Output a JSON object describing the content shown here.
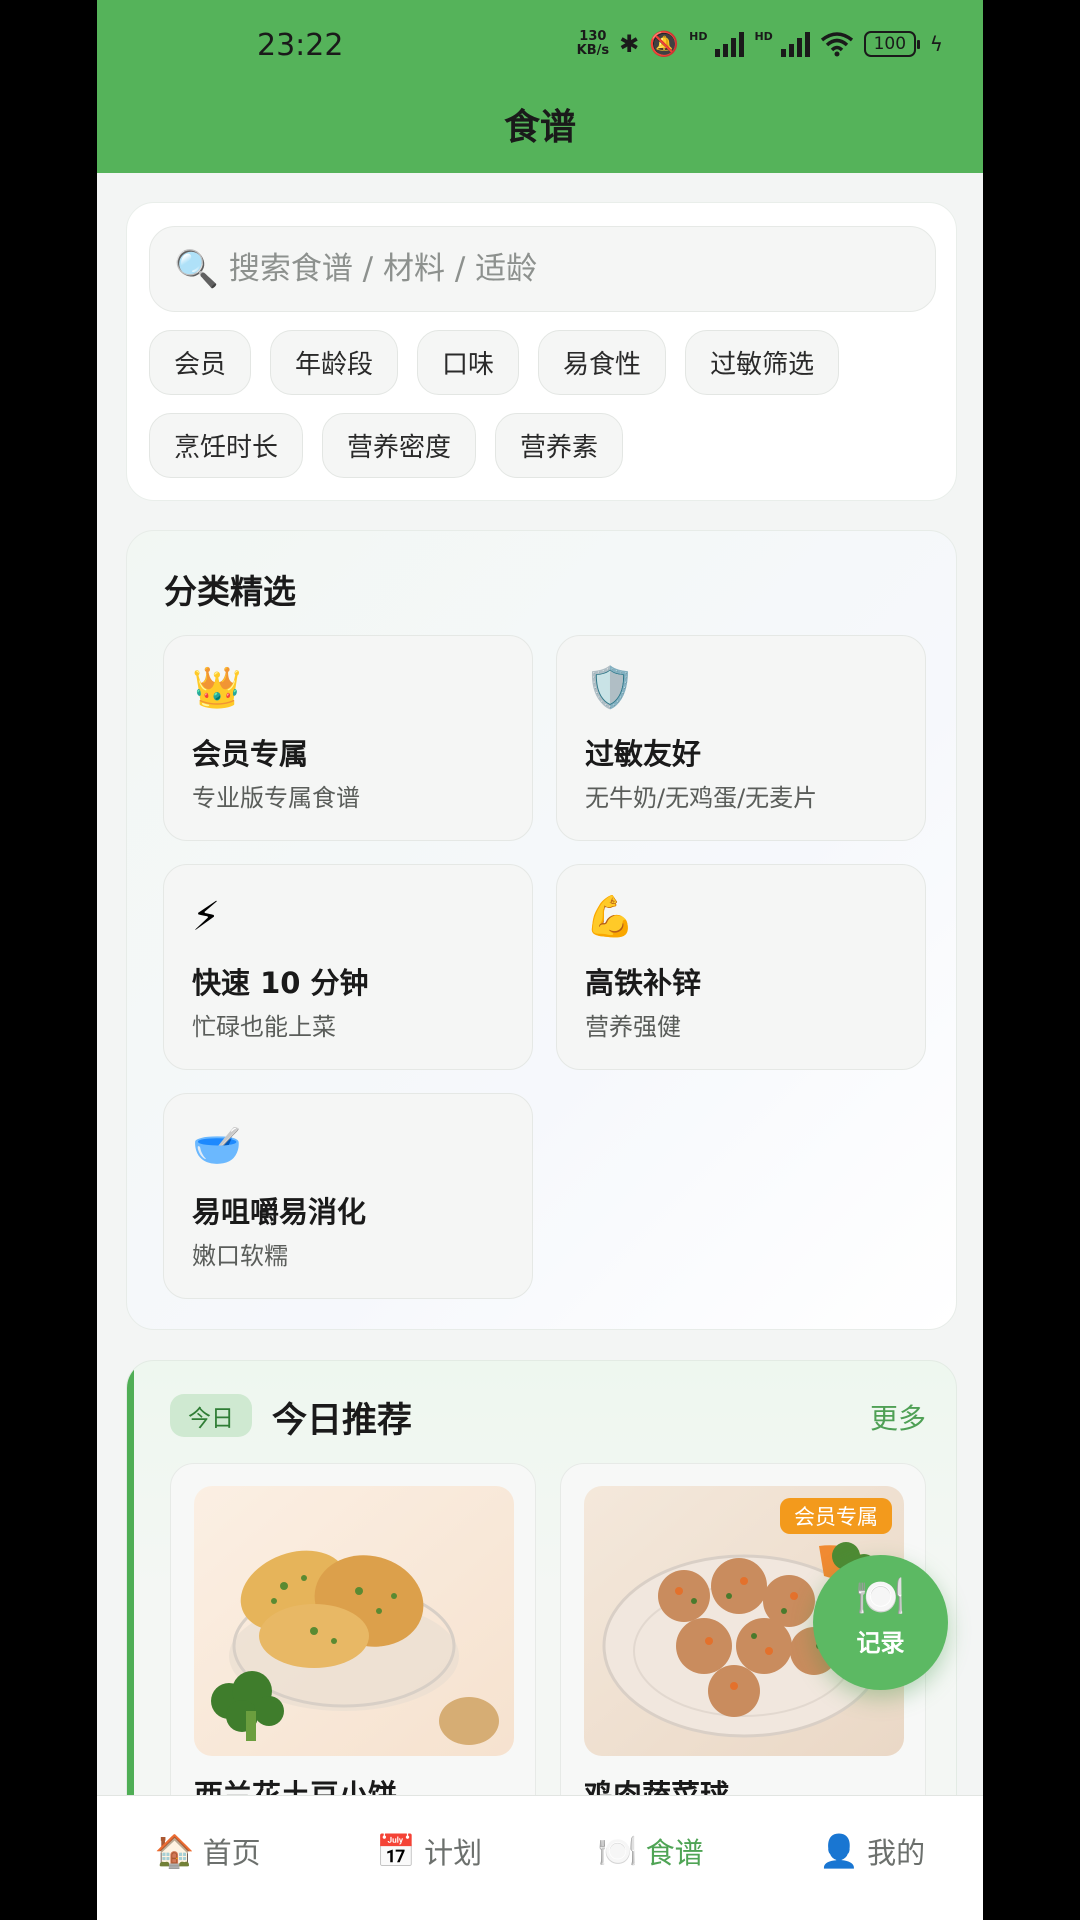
{
  "status_bar": {
    "time": "23:22",
    "net_speed_value": "130",
    "net_speed_unit": "KB/s",
    "hd_label": "HD",
    "battery": "100"
  },
  "header": {
    "title": "食谱"
  },
  "search": {
    "placeholder": "搜索食谱 / 材料 / 适龄",
    "value": "",
    "icon": "search-icon"
  },
  "filters": [
    "会员",
    "年龄段",
    "口味",
    "易食性",
    "过敏筛选",
    "烹饪时长",
    "营养密度",
    "营养素"
  ],
  "categories": {
    "title": "分类精选",
    "items": [
      {
        "icon": "👑",
        "icon_name": "crown-icon",
        "title": "会员专属",
        "subtitle": "专业版专属食谱"
      },
      {
        "icon": "🛡️",
        "icon_name": "shield-icon",
        "title": "过敏友好",
        "subtitle": "无牛奶/无鸡蛋/无麦片"
      },
      {
        "icon": "⚡",
        "icon_name": "lightning-icon",
        "title": "快速 10 分钟",
        "subtitle": "忙碌也能上菜"
      },
      {
        "icon": "💪",
        "icon_name": "muscle-icon",
        "title": "高铁补锌",
        "subtitle": "营养强健"
      },
      {
        "icon": "🥣",
        "icon_name": "bowl-icon",
        "title": "易咀嚼易消化",
        "subtitle": "嫩口软糯"
      }
    ]
  },
  "recommend": {
    "badge": "今日",
    "title": "今日推荐",
    "more": "更多",
    "items": [
      {
        "name": "西兰花土豆小饼",
        "tag": ""
      },
      {
        "name": "鸡肉蔬菜球",
        "tag": "会员专属"
      }
    ]
  },
  "fab": {
    "icon": "🍽️",
    "label": "记录"
  },
  "nav": [
    {
      "icon": "🏠",
      "label": "首页",
      "active": false
    },
    {
      "icon": "📅",
      "label": "计划",
      "active": false
    },
    {
      "icon": "🍽️",
      "label": "食谱",
      "active": true
    },
    {
      "icon": "👤",
      "label": "我的",
      "active": false
    }
  ],
  "colors": {
    "primary": "#55b35a",
    "accent_text": "#4fa455",
    "vip_tag": "#f39a1c"
  }
}
